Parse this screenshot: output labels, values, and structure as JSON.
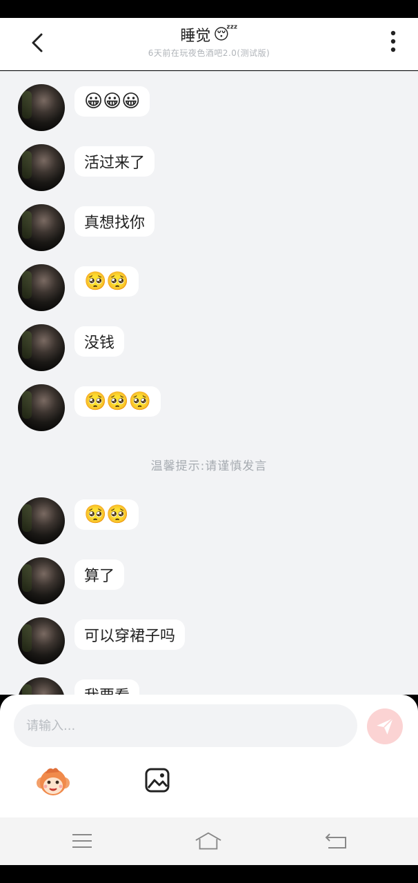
{
  "header": {
    "title": "睡觉",
    "title_emoji": "😴",
    "subtitle": "6天前在玩夜色酒吧2.0(测试版)"
  },
  "messages": [
    {
      "text": "😀😀😀",
      "kind": "emoji"
    },
    {
      "text": "活过来了",
      "kind": "text"
    },
    {
      "text": "真想找你",
      "kind": "text"
    },
    {
      "text": "🥺🥺",
      "kind": "emoji"
    },
    {
      "text": "没钱",
      "kind": "text"
    },
    {
      "text": "🥺🥺🥺",
      "kind": "emoji"
    },
    {
      "text": "🥺🥺",
      "kind": "emoji"
    },
    {
      "text": "算了",
      "kind": "text"
    },
    {
      "text": "可以穿裙子吗",
      "kind": "text"
    },
    {
      "text": "我要看",
      "kind": "text"
    }
  ],
  "notice": "温馨提示:请谨慎发言",
  "composer": {
    "placeholder": "请输入...",
    "value": ""
  },
  "icons": {
    "back": "chevron-left-icon",
    "menu": "more-vertical-icon",
    "send": "paper-plane-icon",
    "emoji_tool": "monkey-face-icon",
    "image_tool": "image-icon",
    "nav_menu": "menu-lines-icon",
    "nav_home": "home-icon",
    "nav_back": "return-icon"
  },
  "colors": {
    "chat_background": "#f2f3f5",
    "bubble": "#ffffff",
    "send_button": "#fbd3d3",
    "send_icon": "#ffffff"
  }
}
